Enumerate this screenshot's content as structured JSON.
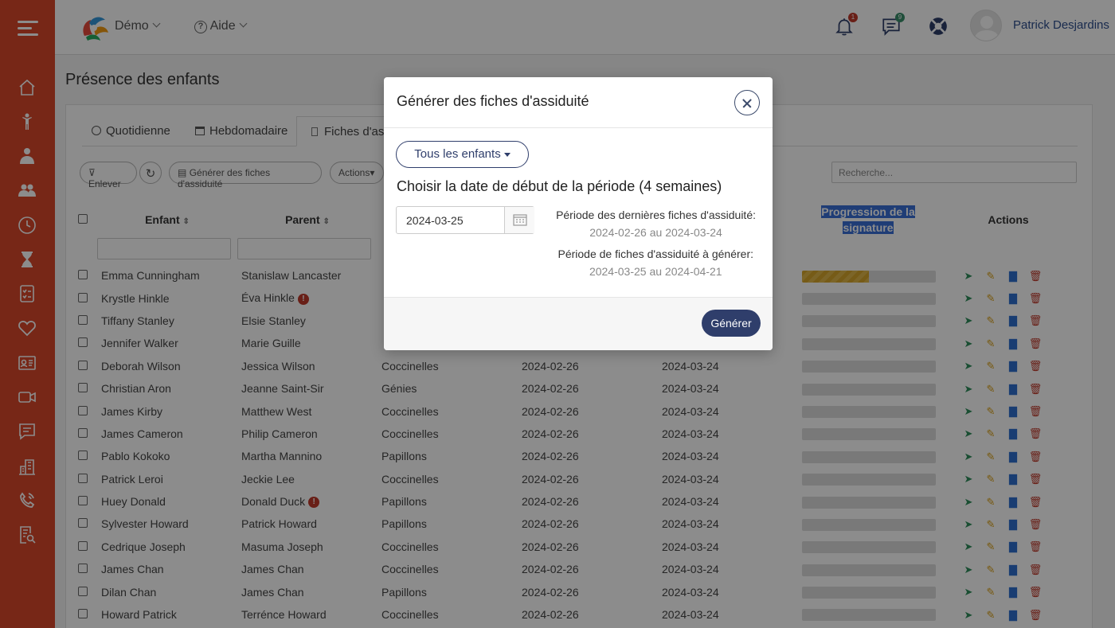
{
  "header": {
    "app_menu_label": "Démo",
    "help_label": "Aide",
    "notifications_count": "1",
    "messages_count": "9",
    "user_name": "Patrick Desjardins"
  },
  "page": {
    "title": "Présence des enfants"
  },
  "tabs": [
    "Quotidienne",
    "Hebdomadaire",
    "Fiches d'ass"
  ],
  "toolbar": {
    "clear_label": "Enlever",
    "generate_label": "Générer des fiches d'assiduité",
    "actions_label": "Actions",
    "search_placeholder": "Recherche..."
  },
  "table": {
    "headers": {
      "child": "Enfant",
      "parent": "Parent",
      "progress": "Progression de la signature",
      "actions": "Actions"
    },
    "rows": [
      {
        "child": "Emma Cunningham",
        "parent": "Stanislaw Lancaster",
        "group": "",
        "start": "",
        "end": "",
        "progress": 0.5,
        "warn": false
      },
      {
        "child": "Krystle Hinkle",
        "parent": "Éva Hinkle",
        "group": "",
        "start": "",
        "end": "",
        "progress": 0,
        "warn": true
      },
      {
        "child": "Tiffany Stanley",
        "parent": "Elsie Stanley",
        "group": "",
        "start": "",
        "end": "",
        "progress": 0,
        "warn": false
      },
      {
        "child": "Jennifer Walker",
        "parent": "Marie Guille",
        "group": "",
        "start": "",
        "end": "",
        "progress": 0,
        "warn": false
      },
      {
        "child": "Deborah Wilson",
        "parent": "Jessica Wilson",
        "group": "Coccinelles",
        "start": "2024-02-26",
        "end": "2024-03-24",
        "progress": 0,
        "warn": false
      },
      {
        "child": "Christian Aron",
        "parent": "Jeanne Saint-Sir",
        "group": "Génies",
        "start": "2024-02-26",
        "end": "2024-03-24",
        "progress": 0,
        "warn": false
      },
      {
        "child": "James Kirby",
        "parent": "Matthew West",
        "group": "Coccinelles",
        "start": "2024-02-26",
        "end": "2024-03-24",
        "progress": 0,
        "warn": false
      },
      {
        "child": "James Cameron",
        "parent": "Philip Cameron",
        "group": "Coccinelles",
        "start": "2024-02-26",
        "end": "2024-03-24",
        "progress": 0,
        "warn": false
      },
      {
        "child": "Pablo Kokoko",
        "parent": "Martha Mannino",
        "group": "Papillons",
        "start": "2024-02-26",
        "end": "2024-03-24",
        "progress": 0,
        "warn": false
      },
      {
        "child": "Patrick Leroi",
        "parent": "Jeckie Lee",
        "group": "Coccinelles",
        "start": "2024-02-26",
        "end": "2024-03-24",
        "progress": 0,
        "warn": false
      },
      {
        "child": "Huey Donald",
        "parent": "Donald Duck",
        "group": "Papillons",
        "start": "2024-02-26",
        "end": "2024-03-24",
        "progress": 0,
        "warn": true
      },
      {
        "child": "Sylvester Howard",
        "parent": "Patrick Howard",
        "group": "Papillons",
        "start": "2024-02-26",
        "end": "2024-03-24",
        "progress": 0,
        "warn": false
      },
      {
        "child": "Cedrique Joseph",
        "parent": "Masuma Joseph",
        "group": "Coccinelles",
        "start": "2024-02-26",
        "end": "2024-03-24",
        "progress": 0,
        "warn": false
      },
      {
        "child": "James Chan",
        "parent": "James Chan",
        "group": "Coccinelles",
        "start": "2024-02-26",
        "end": "2024-03-24",
        "progress": 0,
        "warn": false
      },
      {
        "child": "Dilan Chan",
        "parent": "James Chan",
        "group": "Papillons",
        "start": "2024-02-26",
        "end": "2024-03-24",
        "progress": 0,
        "warn": false
      },
      {
        "child": "Howard Patrick",
        "parent": "Terrénce Howard",
        "group": "Coccinelles",
        "start": "2024-02-26",
        "end": "2024-03-24",
        "progress": 0,
        "warn": false
      }
    ]
  },
  "modal": {
    "title": "Générer des fiches d'assiduité",
    "children_filter": "Tous les enfants",
    "heading": "Choisir la date de début de la période (4 semaines)",
    "start_date": "2024-03-25",
    "last_period_label": "Période des dernières fiches d'assiduité:",
    "last_period_value": "2024-02-26 au 2024-03-24",
    "next_period_label": "Période de fiches d'assiduité à générer:",
    "next_period_value": "2024-03-25 au 2024-04-21",
    "generate_button": "Générer"
  },
  "colors": {
    "sidebar": "#d9472b",
    "primary": "#2f3e6b",
    "progress_fill": "#d8a62a",
    "badge_red": "#c0392b",
    "badge_green": "#3a8f6b"
  }
}
